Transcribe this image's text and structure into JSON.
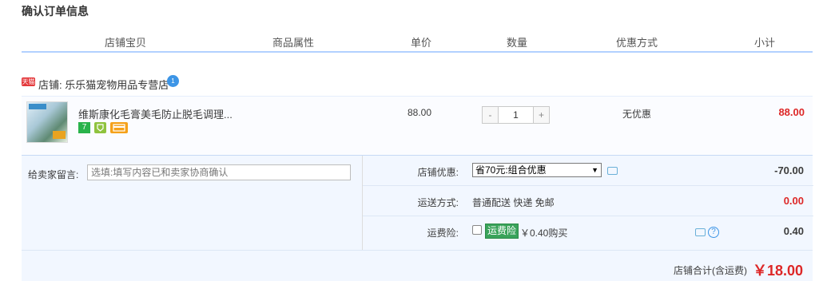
{
  "page_title": "确认订单信息",
  "columns": [
    "店铺宝贝",
    "商品属性",
    "单价",
    "数量",
    "优惠方式",
    "小计"
  ],
  "shop": {
    "badge": "天猫",
    "label": "店铺: 乐乐猫宠物用品专营店",
    "ww_badge": "1"
  },
  "item": {
    "name": "维斯康化毛膏美毛防止脱毛调理...",
    "service_icons": [
      "7",
      "",
      ""
    ],
    "unit_price": "88.00",
    "qty_minus": "-",
    "qty_value": "1",
    "qty_plus": "+",
    "promotion": "无优惠",
    "subtotal": "88.00"
  },
  "message": {
    "label": "给卖家留言:",
    "placeholder": "选填:填写内容已和卖家协商确认"
  },
  "shop_discount": {
    "label": "店铺优惠:",
    "selected": "省70元:组合优惠",
    "value": "-70.00"
  },
  "shipping": {
    "label": "运送方式:",
    "text": "普通配送 快递 免邮",
    "value": "0.00"
  },
  "insurance": {
    "label": "运费险:",
    "tag": "运费险",
    "price": "￥0.40购买",
    "help": "?",
    "value": "0.40"
  },
  "total": {
    "label": "店铺合计(含运费)",
    "value": "￥18.00"
  },
  "colors": {
    "accent_blue": "#b2d1ff",
    "price_red": "#dd2727",
    "panel_bg": "#f2f7ff"
  }
}
